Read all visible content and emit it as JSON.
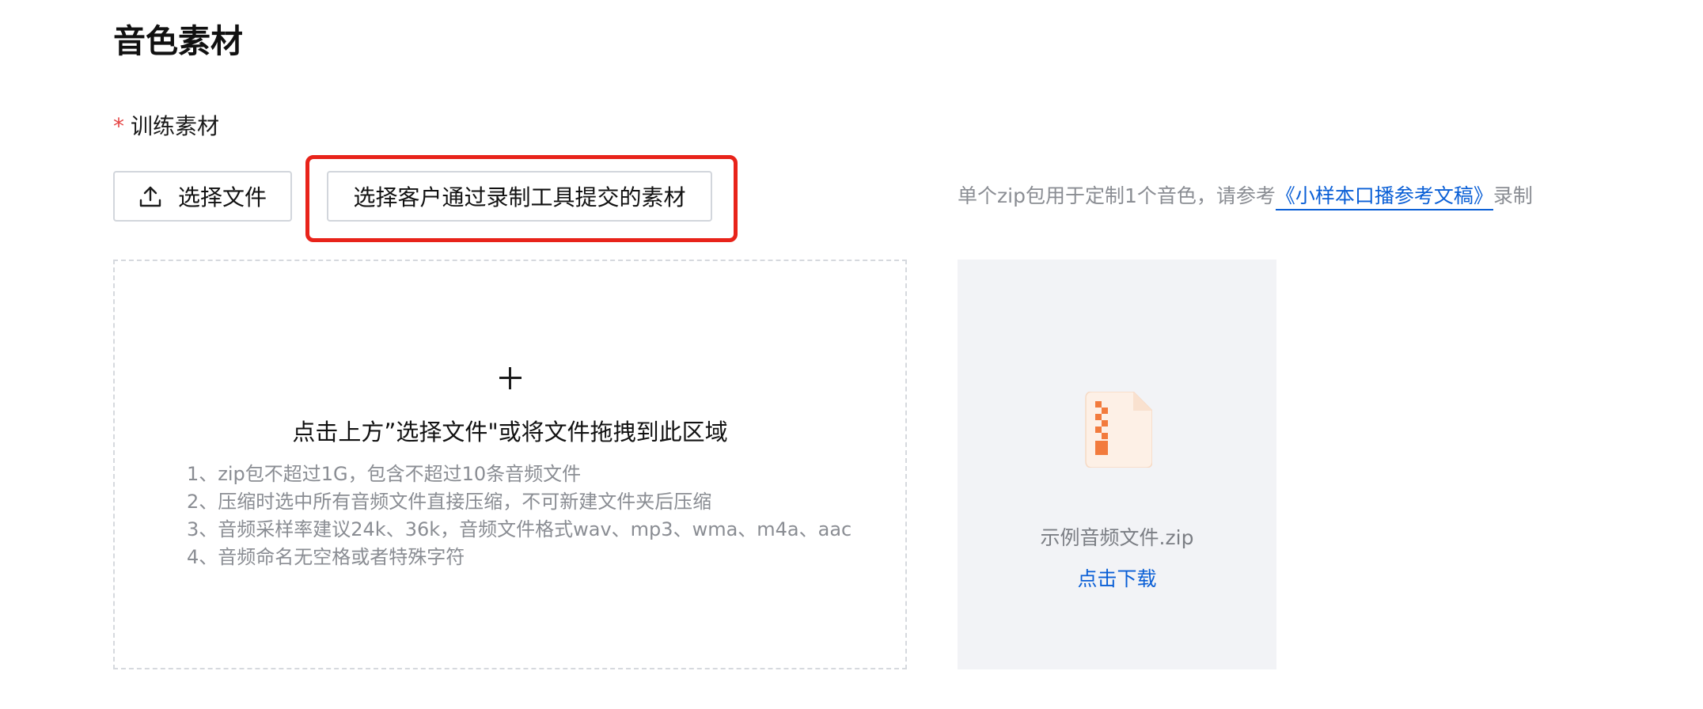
{
  "section": {
    "title": "音色素材"
  },
  "field": {
    "required_mark": "*",
    "label": "训练素材"
  },
  "buttons": {
    "upload_icon": "upload-icon",
    "select_file_label": "选择文件",
    "select_customer_label": "选择客户通过录制工具提交的素材"
  },
  "hint": {
    "prefix": "单个zip包用于定制1个音色，请参考",
    "link_text": "《小样本口播参考文稿》",
    "suffix": "录制"
  },
  "dropzone": {
    "plus_icon": "plus-icon",
    "title": "点击上方”选择文件\"或将文件拖拽到此区域",
    "rules": [
      "1、zip包不超过1G，包含不超过10条音频文件",
      "2、压缩时选中所有音频文件直接压缩，不可新建文件夹后压缩",
      "3、音频采样率建议24k、36k，音频文件格式wav、mp3、wma、m4a、aac",
      "4、音频命名无空格或者特殊字符"
    ]
  },
  "sample": {
    "icon": "zip-file-icon",
    "file_name": "示例音频文件.zip",
    "download_label": "点击下载"
  },
  "colors": {
    "accent": "#0a5fd6",
    "highlight": "#e8231a",
    "required": "#e54545",
    "zip_icon": "#f27b3d"
  }
}
